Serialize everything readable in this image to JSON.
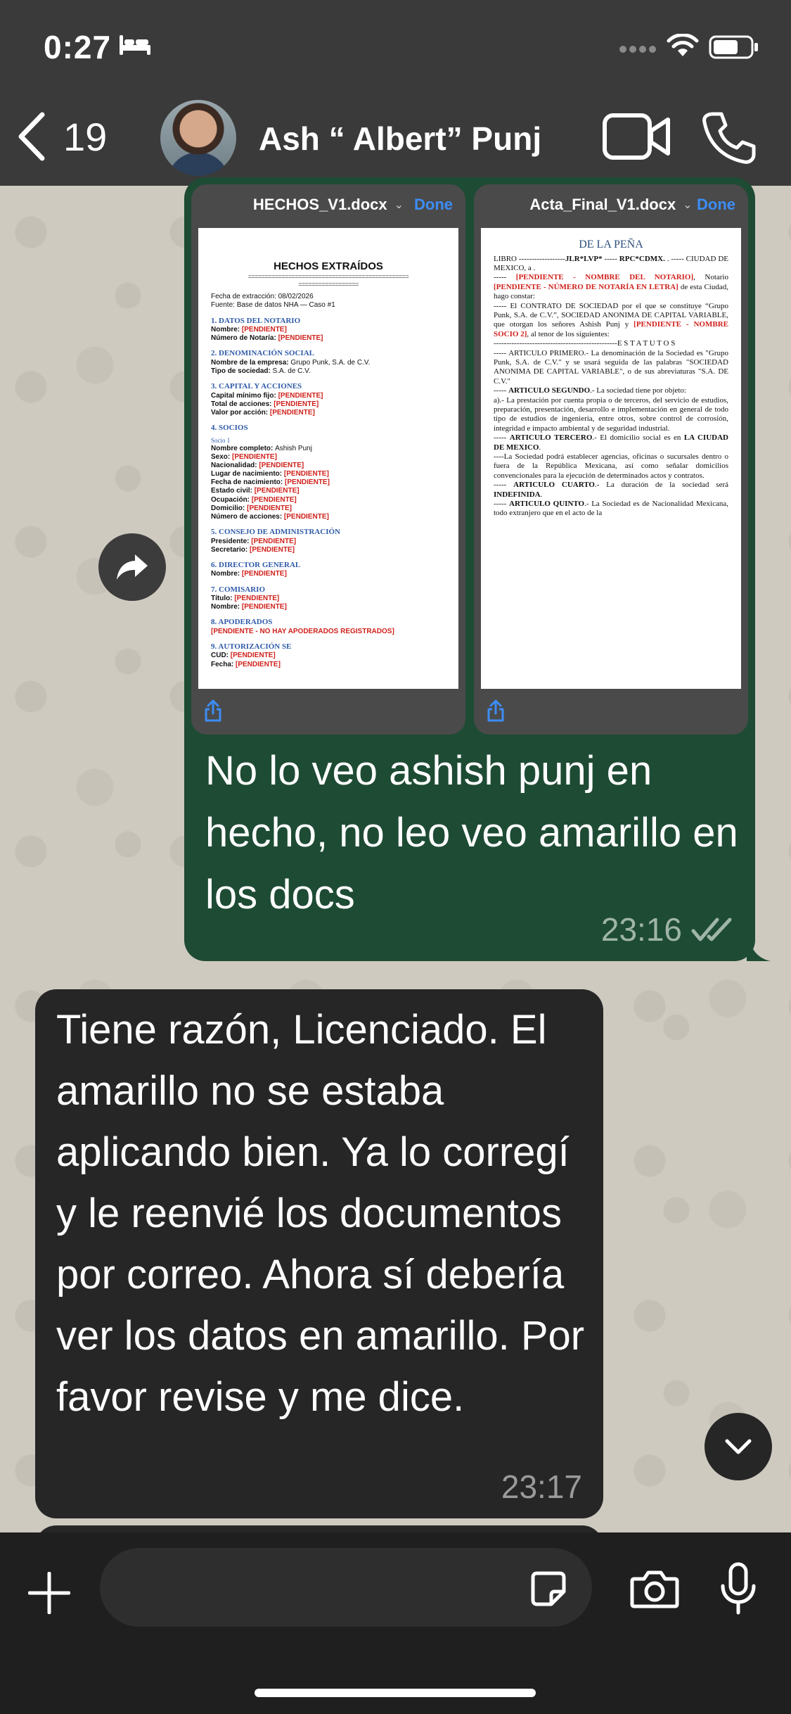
{
  "status_bar": {
    "time": "0:27",
    "icons": [
      "bed-icon",
      "signal-icon",
      "wifi-icon",
      "battery-icon"
    ]
  },
  "header": {
    "back_count": "19",
    "contact_name": "Ash “ Albert” Punj",
    "icons": [
      "back-chevron-icon",
      "video-call-icon",
      "phone-call-icon"
    ]
  },
  "outgoing_message": {
    "attachments": [
      {
        "filename": "HECHOS_V1.docx",
        "done_label": "Done",
        "page": {
          "title": "HECHOS EXTRAÍDOS",
          "rule": "================================================",
          "rule_short": "==================",
          "meta": [
            "Fecha de extracción: 08/02/2026",
            "Fuente: Base de datos NHA — Caso #1"
          ],
          "sections": [
            {
              "heading": "1. DATOS DEL NOTARIO",
              "rows": [
                {
                  "label": "Nombre:",
                  "value": "[PENDIENTE]",
                  "pending": true
                },
                {
                  "label": "Número de Notaría:",
                  "value": "[PENDIENTE]",
                  "pending": true
                }
              ]
            },
            {
              "heading": "2. DENOMINACIÓN SOCIAL",
              "rows": [
                {
                  "label": "Nombre de la empresa:",
                  "value": "Grupo Punk, S.A. de C.V.",
                  "pending": false
                },
                {
                  "label": "Tipo de sociedad:",
                  "value": "S.A. de C.V.",
                  "pending": false
                }
              ]
            },
            {
              "heading": "3. CAPITAL Y ACCIONES",
              "rows": [
                {
                  "label": "Capital mínimo fijo:",
                  "value": "[PENDIENTE]",
                  "pending": true
                },
                {
                  "label": "Total de acciones:",
                  "value": "[PENDIENTE]",
                  "pending": true
                },
                {
                  "label": "Valor por acción:",
                  "value": "[PENDIENTE]",
                  "pending": true
                }
              ]
            },
            {
              "heading": "4. SOCIOS",
              "sub": "Socio 1",
              "rows": [
                {
                  "label": "Nombre completo:",
                  "value": "Ashish Punj",
                  "pending": false
                },
                {
                  "label": "Sexo:",
                  "value": "[PENDIENTE]",
                  "pending": true
                },
                {
                  "label": "Nacionalidad:",
                  "value": "[PENDIENTE]",
                  "pending": true
                },
                {
                  "label": "Lugar de nacimiento:",
                  "value": "[PENDIENTE]",
                  "pending": true
                },
                {
                  "label": "Fecha de nacimiento:",
                  "value": "[PENDIENTE]",
                  "pending": true
                },
                {
                  "label": "Estado civil:",
                  "value": "[PENDIENTE]",
                  "pending": true
                },
                {
                  "label": "Ocupación:",
                  "value": "[PENDIENTE]",
                  "pending": true
                },
                {
                  "label": "Domicilio:",
                  "value": "[PENDIENTE]",
                  "pending": true
                },
                {
                  "label": "Número de acciones:",
                  "value": "[PENDIENTE]",
                  "pending": true
                }
              ]
            },
            {
              "heading": "5. CONSEJO DE ADMINISTRACIÓN",
              "rows": [
                {
                  "label": "Presidente:",
                  "value": "[PENDIENTE]",
                  "pending": true
                },
                {
                  "label": "Secretario:",
                  "value": "[PENDIENTE]",
                  "pending": true
                }
              ]
            },
            {
              "heading": "6. DIRECTOR GENERAL",
              "rows": [
                {
                  "label": "Nombre:",
                  "value": "[PENDIENTE]",
                  "pending": true
                }
              ]
            },
            {
              "heading": "7. COMISARIO",
              "rows": [
                {
                  "label": "Título:",
                  "value": "[PENDIENTE]",
                  "pending": true
                },
                {
                  "label": "Nombre:",
                  "value": "[PENDIENTE]",
                  "pending": true
                }
              ]
            },
            {
              "heading": "8. APODERADOS",
              "rows": [
                {
                  "label": "",
                  "value": "[PENDIENTE - NO HAY APODERADOS REGISTRADOS]",
                  "pending": true
                }
              ]
            },
            {
              "heading": "9. AUTORIZACIÓN SE",
              "rows": [
                {
                  "label": "CUD:",
                  "value": "[PENDIENTE]",
                  "pending": true
                },
                {
                  "label": "Fecha:",
                  "value": "[PENDIENTE]",
                  "pending": true
                }
              ]
            }
          ]
        }
      },
      {
        "filename": "Acta_Final_V1.docx",
        "done_label": "Done",
        "page": {
          "logo": "DE LA PEÑA",
          "paragraphs": [
            [
              {
                "t": "LIBRO ------------------"
              },
              {
                "t": "JLR*LVP*",
                "b": true
              },
              {
                "t": " ----- "
              },
              {
                "t": "RPC*CDMX.",
                "b": true
              },
              {
                "t": " . ----- CIUDAD DE MEXICO, a ."
              }
            ],
            [
              {
                "t": "----- "
              },
              {
                "t": "[PENDIENTE - NOMBRE DEL NOTARIO]",
                "red": true
              },
              {
                "t": ", Notario "
              },
              {
                "t": "[PENDIENTE - NÚMERO DE NOTARÍA EN LETRA]",
                "red": true
              },
              {
                "t": " de esta Ciudad, hago constar:"
              }
            ],
            [
              {
                "t": "----- El CONTRATO DE SOCIEDAD por el que se constituye “Grupo Punk, S.A. de C.V.”, SOCIEDAD ANONIMA DE CAPITAL VARIABLE, que otorgan los señores Ashish Punj y "
              },
              {
                "t": "[PENDIENTE - NOMBRE SOCIO 2]",
                "red": true
              },
              {
                "t": ", al tenor de los siguientes:"
              }
            ],
            [
              {
                "t": "------------------------------------------------E S T A T U T O S"
              }
            ],
            [
              {
                "t": "----- ARTICULO PRIMERO.- La denominación de la Sociedad es \"Grupo Punk, S.A. de C.V.\" y se usará seguida de las palabras \"SOCIEDAD ANONIMA DE CAPITAL VARIABLE\", o de sus abreviaturas \"S.A. DE C.V.\""
              }
            ],
            [
              {
                "t": "----- "
              },
              {
                "t": "ARTICULO SEGUNDO",
                "b": true
              },
              {
                "t": ".- La sociedad tiene por objeto:"
              }
            ],
            [
              {
                "t": "a).- La prestación por cuenta propia o de terceros, del servicio de estudios, preparación, presentación, desarrollo e implementación en general de todo tipo de estudios de ingeniería, entre otros, sobre control de corrosión, integridad e impacto ambiental y de seguridad industrial."
              }
            ],
            [
              {
                "t": "----- "
              },
              {
                "t": "ARTICULO TERCERO",
                "b": true
              },
              {
                "t": ".- El domicilio social es en "
              },
              {
                "t": "LA CIUDAD DE MEXICO",
                "b": true
              },
              {
                "t": "."
              }
            ],
            [
              {
                "t": "----La Sociedad podrá establecer agencias, oficinas o sucursales dentro o fuera de la República Mexicana, así como señalar domicilios convencionales para la ejecución de determinados actos y contratos."
              }
            ],
            [
              {
                "t": "----- "
              },
              {
                "t": "ARTICULO CUARTO",
                "b": true
              },
              {
                "t": ".- La duración de la sociedad será "
              },
              {
                "t": "INDEFINIDA",
                "b": true
              },
              {
                "t": "."
              }
            ],
            [
              {
                "t": "----- "
              },
              {
                "t": "ARTICULO QUINTO",
                "b": true
              },
              {
                "t": ".- La Sociedad es de Nacionalidad Mexicana, todo extranjero que en el acto de la"
              }
            ]
          ]
        }
      }
    ],
    "text": "No lo veo ashish punj en hecho, no leo veo amarillo en los docs",
    "time": "23:16",
    "status": "read"
  },
  "incoming_message": {
    "text": "Tiene razón, Licenciado. El amarillo no se estaba aplicando bien. Ya lo corregí y le reenvié los documentos por correo. Ahora sí debería ver los datos en amarillo. Por favor revise y me dice.",
    "time": "23:17"
  },
  "input_bar": {
    "placeholder": "",
    "value": ""
  },
  "colors": {
    "outgoing_bubble": "#1e4b34",
    "incoming_bubble": "#262626",
    "header_bg": "#3a3a3a",
    "link_blue": "#3d8df5",
    "pending_red": "#d0211b"
  }
}
